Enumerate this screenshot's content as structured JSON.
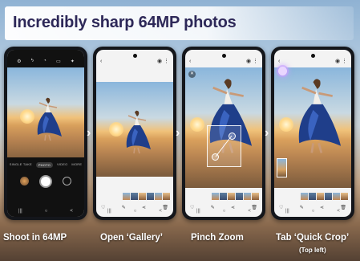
{
  "banner": {
    "title": "Incredibly sharp 64MP photos"
  },
  "steps": [
    {
      "caption": "Shoot in 64MP"
    },
    {
      "caption": "Open ‘Gallery’"
    },
    {
      "caption": "Pinch Zoom"
    },
    {
      "caption": "Tab ‘Quick Crop’",
      "subcaption": "(Top left)"
    }
  ],
  "camera": {
    "modes": [
      "SINGLE TAKE",
      "PHOTO",
      "VIDEO",
      "MORE"
    ],
    "active_mode": "PHOTO"
  },
  "icons": {
    "next_step": "chevron-right-icon",
    "back": "back-arrow-icon",
    "close": "close-icon"
  },
  "nav_glyphs": {
    "recent": "|||",
    "home": "○",
    "back": "<"
  },
  "colors": {
    "title": "#2d2858",
    "banner_bg": "#ffffff",
    "caption": "#ffffff"
  }
}
